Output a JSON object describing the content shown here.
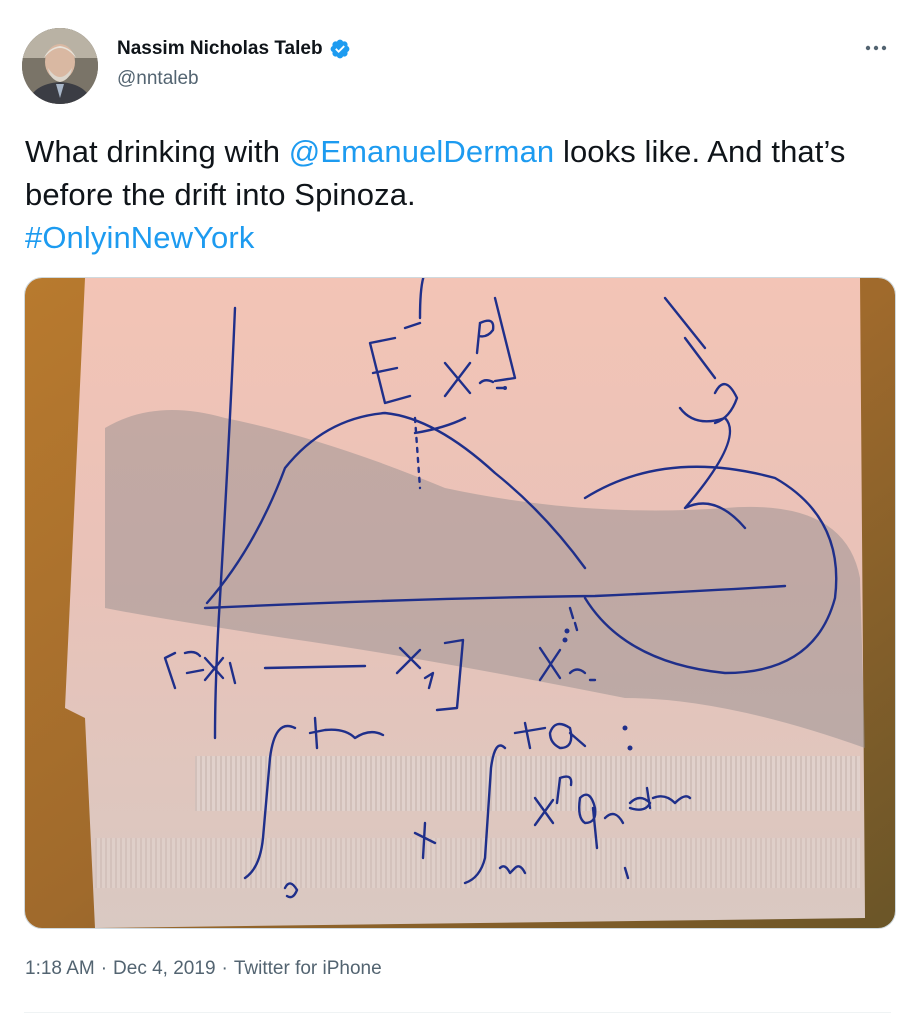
{
  "author": {
    "name": "Nassim Nicholas Taleb",
    "handle": "@nntaleb",
    "verified": true
  },
  "icons": {
    "verified": "verified-badge-icon",
    "more": "more-options-icon"
  },
  "tweet": {
    "text_part1": "What drinking with ",
    "mention": "@EmanuelDerman",
    "text_part2": " looks like. And that’s before the drift into Spinoza.",
    "hashtag": "#OnlyinNewYork"
  },
  "meta": {
    "time": "1:18 AM",
    "sep1": "·",
    "date": "Dec 4, 2019",
    "sep2": "·",
    "source": "Twitter for iPhone"
  },
  "colors": {
    "link": "#1d9bf0",
    "text": "#0f1419",
    "secondary": "#536471",
    "ink": "#1f2f8a"
  }
}
